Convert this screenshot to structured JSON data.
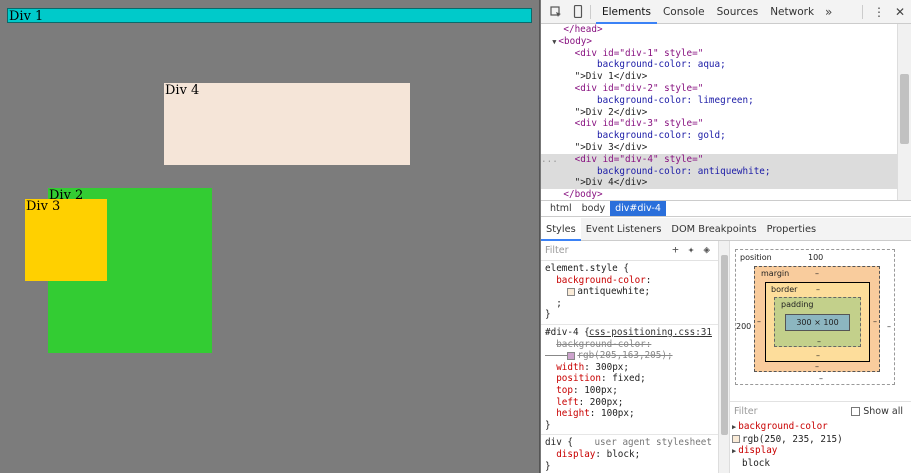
{
  "page": {
    "divs": [
      {
        "id": "div-1",
        "label": "Div 1",
        "color": "#00caca"
      },
      {
        "id": "div-2",
        "label": "Div 2",
        "color": "#33cc33"
      },
      {
        "id": "div-3",
        "label": "Div 3",
        "color": "#ffd000"
      },
      {
        "id": "div-4",
        "label": "Div 4",
        "color": "#f5e5d8"
      }
    ]
  },
  "devtools": {
    "tabs": [
      "Elements",
      "Console",
      "Sources",
      "Network"
    ],
    "active_tab": "Elements",
    "more_tabs": "»",
    "tree": {
      "head_close": "</head>",
      "body_open": "<body>",
      "div1_open": "<div id=\"div-1\" style=\"",
      "div1_style": "background-color: aqua;",
      "div1_close": "\">Div 1</div>",
      "div2_open": "<div id=\"div-2\" style=\"",
      "div2_style": "background-color: limegreen;",
      "div2_close": "\">Div 2</div>",
      "div3_open": "<div id=\"div-3\" style=\"",
      "div3_style": "background-color: gold;",
      "div3_close": "\">Div 3</div>",
      "div4_open": "<div id=\"div-4\" style=\"",
      "div4_style": "background-color: antiquewhite;",
      "div4_close": "\">Div 4</div>",
      "body_close": "</body>",
      "ellipsis": "..."
    },
    "breadcrumbs": [
      "html",
      "body",
      "div#div-4"
    ],
    "subtabs": [
      "Styles",
      "Event Listeners",
      "DOM Breakpoints",
      "Properties"
    ],
    "styles": {
      "filter_placeholder": "Filter",
      "element_style_selector": "element.style {",
      "element_prop": "background-color",
      "element_value": "antiquewhite;",
      "element_swatch": "#faebd7",
      "semicolon_line": ";",
      "close_brace": "}",
      "rule2_selector": "#div-4 {",
      "rule2_source": "css-positioning.css:31",
      "rule2_struck_prop": "background-color:",
      "rule2_struck_value": "rgb(205,163,205);",
      "rule2_struck_swatch": "#cda3cd",
      "rule2_props": [
        {
          "name": "width",
          "value": "300px;"
        },
        {
          "name": "position",
          "value": "fixed;"
        },
        {
          "name": "top",
          "value": "100px;"
        },
        {
          "name": "left",
          "value": "200px;"
        },
        {
          "name": "height",
          "value": "100px;"
        }
      ],
      "rule3_selector": "div {",
      "rule3_source": "user agent stylesheet",
      "rule3_prop": "display",
      "rule3_value": "block;"
    },
    "boxmodel": {
      "position_label": "position",
      "position_top": "100",
      "position_left": "200",
      "margin_label": "margin",
      "border_label": "border",
      "padding_label": "padding",
      "dash": "–",
      "content_size": "300 × 100"
    },
    "computed": {
      "filter_placeholder": "Filter",
      "show_all": "Show all",
      "items": [
        {
          "name": "background-color",
          "value": "rgb(250, 235, 215)",
          "swatch": "#faebd7"
        },
        {
          "name": "display",
          "value": "block"
        }
      ]
    }
  }
}
